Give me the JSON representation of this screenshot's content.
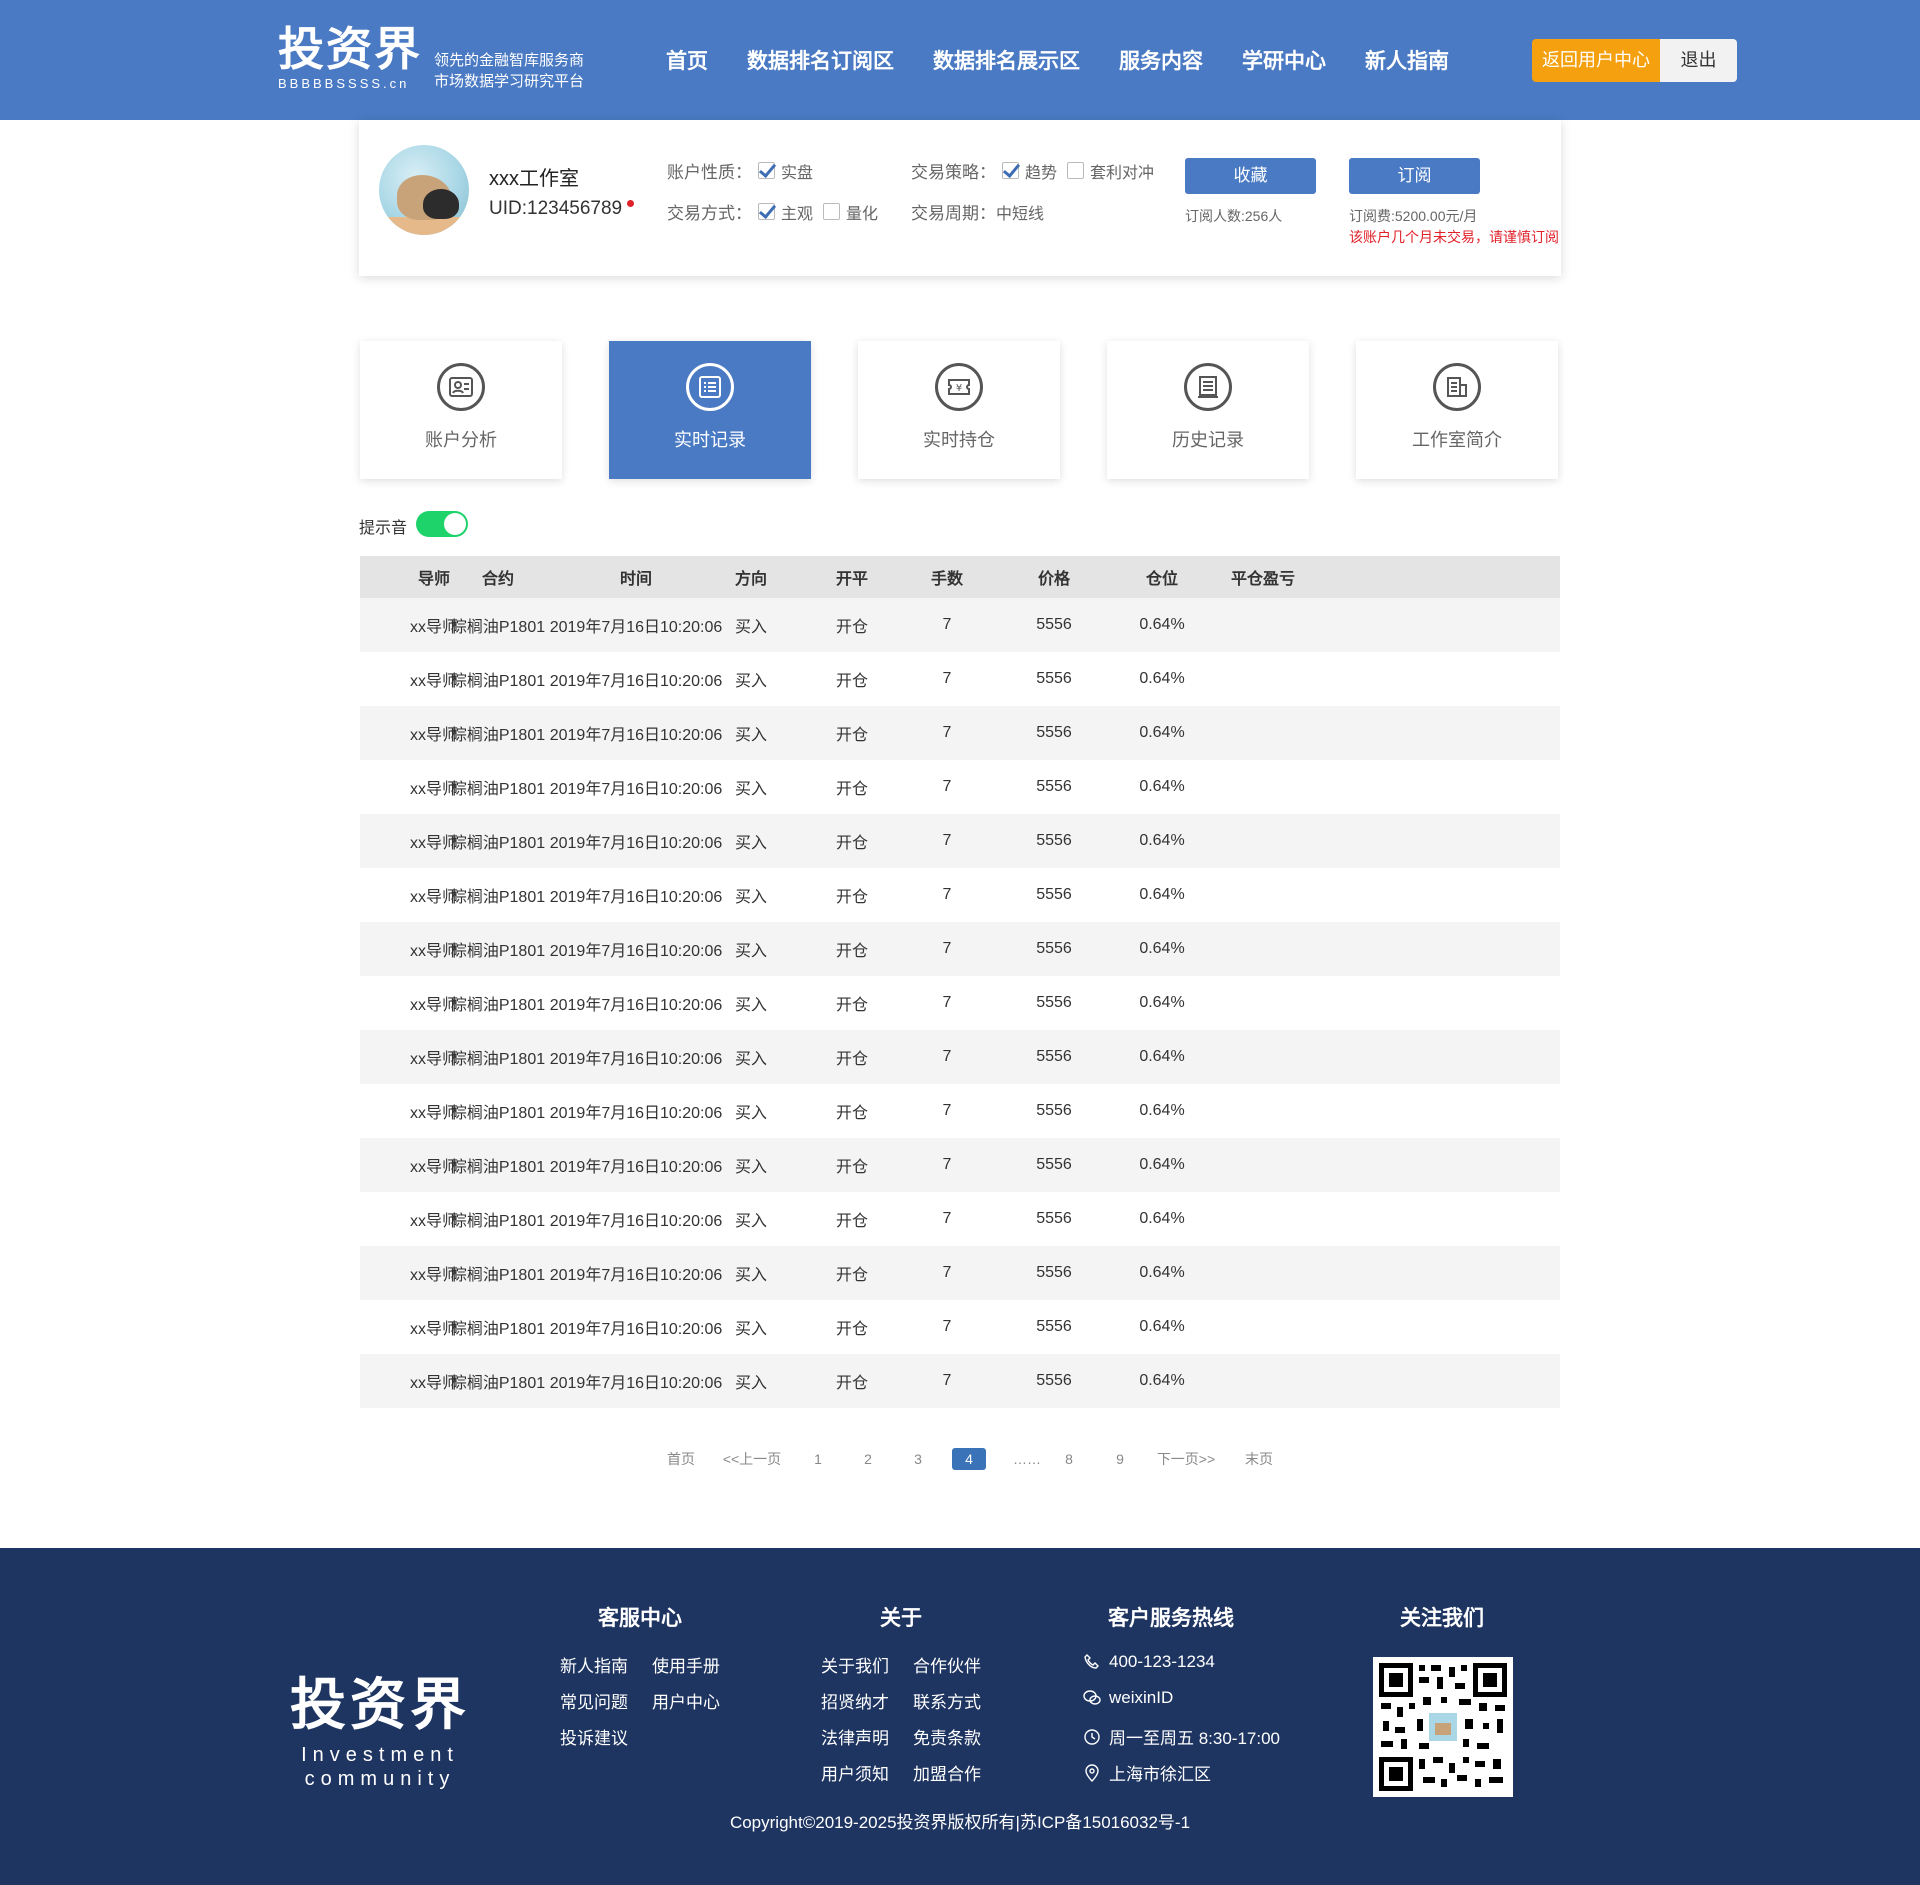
{
  "header": {
    "logo": "投资界",
    "logo_sub": "BBBBBSSSS.cn",
    "slogan_line1": "领先的金融智库服务商",
    "slogan_line2": "市场数据学习研究平台",
    "nav": [
      "首页",
      "数据排名订阅区",
      "数据排名展示区",
      "服务内容",
      "学研中心",
      "新人指南"
    ],
    "return_button": "返回用户中心",
    "logout_button": "退出"
  },
  "profile": {
    "name": "xxx工作室",
    "uid": "UID:123456789",
    "account_type_label": "账户性质：",
    "account_type_option": "实盘",
    "trade_mode_label": "交易方式：",
    "trade_mode_options": [
      "主观",
      "量化"
    ],
    "strategy_label": "交易策略：",
    "strategy_options": [
      "趋势",
      "套利对冲"
    ],
    "period_label": "交易周期：",
    "period_value": "中短线",
    "collect_button": "收藏",
    "subscribe_button": "订阅",
    "subscriber_count": "订阅人数:256人",
    "subscription_fee": "订阅费:5200.00元/月",
    "warning": "该账户几个月未交易，请谨慎订阅"
  },
  "tabs": [
    "账户分析",
    "实时记录",
    "实时持仓",
    "历史记录",
    "工作室简介"
  ],
  "active_tab": 1,
  "sound": {
    "label": "提示音",
    "enabled": true,
    "toggle_color": "#1fd36b"
  },
  "table": {
    "headers": [
      "导师",
      "合约",
      "时间",
      "方向",
      "开平",
      "手数",
      "价格",
      "仓位",
      "平仓盈亏"
    ],
    "rows": [
      [
        "xx导师",
        "棕榈油P1801",
        "2019年7月16日10:20:06",
        "买入",
        "开仓",
        "7",
        "5556",
        "0.64%",
        ""
      ],
      [
        "xx导师",
        "棕榈油P1801",
        "2019年7月16日10:20:06",
        "买入",
        "开仓",
        "7",
        "5556",
        "0.64%",
        ""
      ],
      [
        "xx导师",
        "棕榈油P1801",
        "2019年7月16日10:20:06",
        "买入",
        "开仓",
        "7",
        "5556",
        "0.64%",
        ""
      ],
      [
        "xx导师",
        "棕榈油P1801",
        "2019年7月16日10:20:06",
        "买入",
        "开仓",
        "7",
        "5556",
        "0.64%",
        ""
      ],
      [
        "xx导师",
        "棕榈油P1801",
        "2019年7月16日10:20:06",
        "买入",
        "开仓",
        "7",
        "5556",
        "0.64%",
        ""
      ],
      [
        "xx导师",
        "棕榈油P1801",
        "2019年7月16日10:20:06",
        "买入",
        "开仓",
        "7",
        "5556",
        "0.64%",
        ""
      ],
      [
        "xx导师",
        "棕榈油P1801",
        "2019年7月16日10:20:06",
        "买入",
        "开仓",
        "7",
        "5556",
        "0.64%",
        ""
      ],
      [
        "xx导师",
        "棕榈油P1801",
        "2019年7月16日10:20:06",
        "买入",
        "开仓",
        "7",
        "5556",
        "0.64%",
        ""
      ],
      [
        "xx导师",
        "棕榈油P1801",
        "2019年7月16日10:20:06",
        "买入",
        "开仓",
        "7",
        "5556",
        "0.64%",
        ""
      ],
      [
        "xx导师",
        "棕榈油P1801",
        "2019年7月16日10:20:06",
        "买入",
        "开仓",
        "7",
        "5556",
        "0.64%",
        ""
      ],
      [
        "xx导师",
        "棕榈油P1801",
        "2019年7月16日10:20:06",
        "买入",
        "开仓",
        "7",
        "5556",
        "0.64%",
        ""
      ],
      [
        "xx导师",
        "棕榈油P1801",
        "2019年7月16日10:20:06",
        "买入",
        "开仓",
        "7",
        "5556",
        "0.64%",
        ""
      ],
      [
        "xx导师",
        "棕榈油P1801",
        "2019年7月16日10:20:06",
        "买入",
        "开仓",
        "7",
        "5556",
        "0.64%",
        ""
      ],
      [
        "xx导师",
        "棕榈油P1801",
        "2019年7月16日10:20:06",
        "买入",
        "开仓",
        "7",
        "5556",
        "0.64%",
        ""
      ],
      [
        "xx导师",
        "棕榈油P1801",
        "2019年7月16日10:20:06",
        "买入",
        "开仓",
        "7",
        "5556",
        "0.64%",
        ""
      ]
    ]
  },
  "pagination": {
    "items": [
      "首页",
      "<<上一页",
      "1",
      "2",
      "3",
      "4",
      "……",
      "8",
      "9",
      "下一页>>",
      "末页"
    ],
    "current": "4"
  },
  "footer": {
    "logo": "投资界",
    "logo_sub_line1": "Investment",
    "logo_sub_line2": "community",
    "service_title": "客服中心",
    "service_links": [
      "新人指南",
      "使用手册",
      "常见问题",
      "用户中心",
      "投诉建议"
    ],
    "about_title": "关于",
    "about_links": [
      "关于我们",
      "合作伙伴",
      "招贤纳才",
      "联系方式",
      "法律声明",
      "免责条款",
      "用户须知",
      "加盟合作"
    ],
    "hotline_title": "客户服务热线",
    "phone": "400-123-1234",
    "wechat": "weixinID",
    "hours": "周一至周五 8:30-17:00",
    "address": "上海市徐汇区",
    "follow_title": "关注我们",
    "copyright": "Copyright©2019-2025投资界版权所有|苏ICP备15016032号-1"
  },
  "colors": {
    "brand_blue": "#4a7ac3",
    "orange": "#f5a00f",
    "footer_navy": "#1e3461",
    "warning_red": "#e0212a"
  }
}
